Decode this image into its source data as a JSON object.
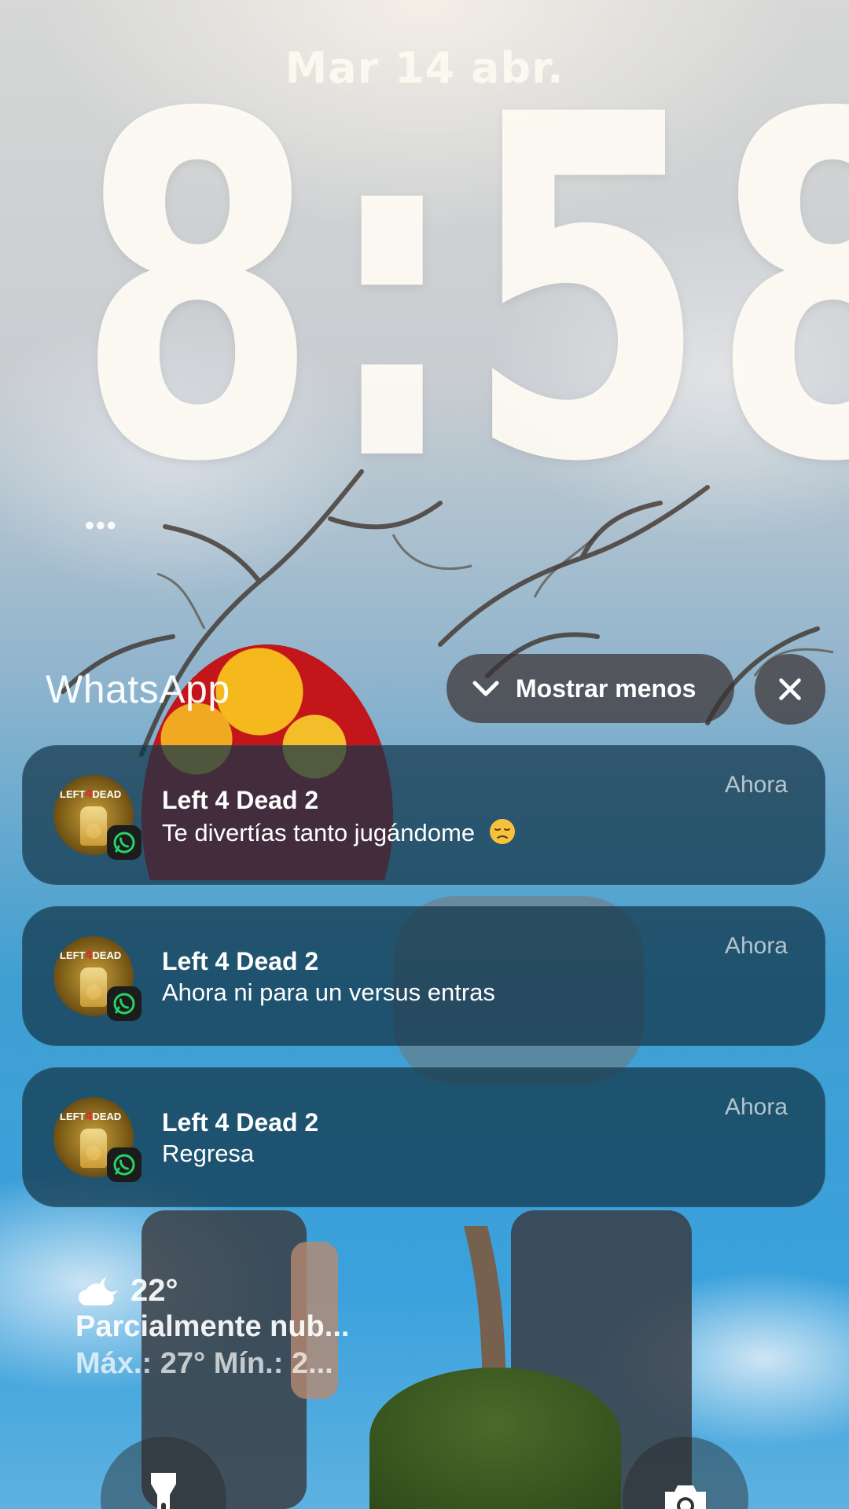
{
  "lockscreen": {
    "date": "Mar 14 abr.",
    "time": "8:58"
  },
  "notification_group": {
    "app_name": "WhatsApp",
    "show_less_label": "Mostrar menos",
    "notifications": [
      {
        "sender": "Left 4 Dead 2",
        "message": "Te divertías tanto jugándome",
        "emoji": "disappointed-face-emoji",
        "time": "Ahora"
      },
      {
        "sender": "Left 4 Dead 2",
        "message": "Ahora ni para un versus entras",
        "time": "Ahora"
      },
      {
        "sender": "Left 4 Dead 2",
        "message": "Regresa",
        "time": "Ahora"
      }
    ]
  },
  "weather": {
    "icon": "partly-cloudy-night-icon",
    "temperature": "22°",
    "condition": "Parcialmente nub...",
    "range": "Máx.: 27° Mín.: 2..."
  },
  "icons": {
    "flashlight": "flashlight-icon",
    "camera": "camera-icon"
  },
  "colors": {
    "notification_bg": "#123448",
    "whatsapp_green": "#25D366",
    "pill_bg": "#3c3232"
  }
}
